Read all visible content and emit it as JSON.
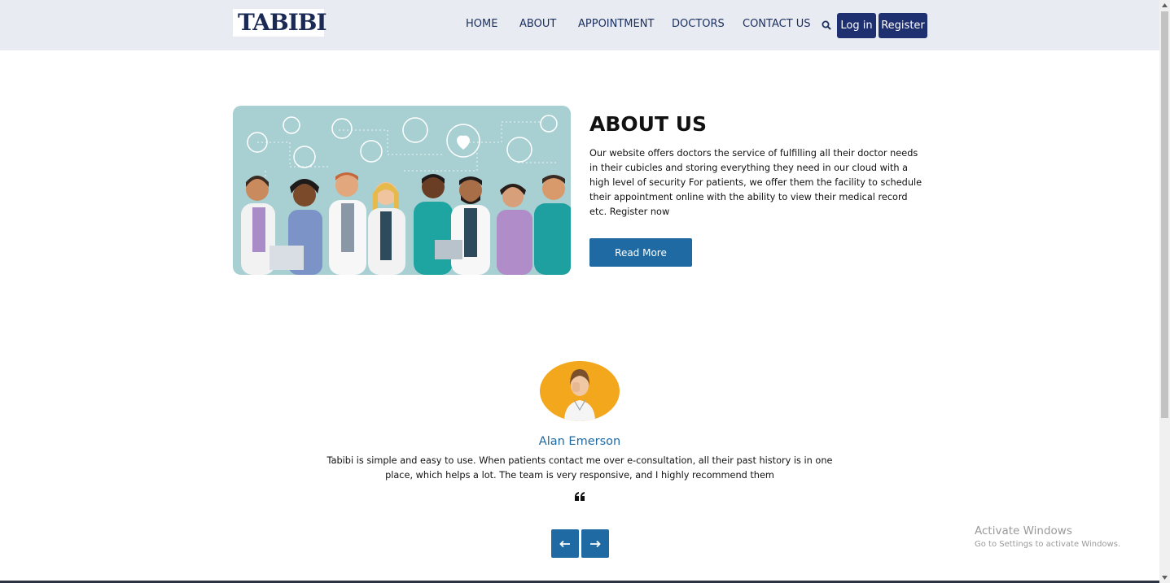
{
  "header": {
    "logo_text": "TABIBI",
    "nav": [
      "HOME",
      "ABOUT",
      "APPOINTMENT",
      "DOCTORS",
      "CONTACT US"
    ],
    "search_icon": "search-icon",
    "login_label": "Log in",
    "register_label": "Register"
  },
  "about": {
    "title": "ABOUT US",
    "text": "Our website offers doctors the service of fulfilling all their doctor needs in their cubicles and storing everything they need in our cloud with a high level of security For patients, we offer them the facility to schedule their appointment online with the ability to view their medical record etc. Register now",
    "button": "Read More"
  },
  "testimonial": {
    "name": "Alan Emerson",
    "text": "Tabibi is simple and easy to use. When patients contact me over e-consultation, all their past history is in one place, which helps a lot. The team is very responsive, and I highly recommend them",
    "quote_icon": "quote-icon",
    "prev_icon": "arrow-left-icon",
    "next_icon": "arrow-right-icon"
  },
  "windows_watermark": {
    "title": "Activate Windows",
    "subtitle": "Go to Settings to activate Windows."
  },
  "colors": {
    "topbar": "#e8ebf1",
    "navy": "#1f3070",
    "accent_blue": "#1f6aa2",
    "avatar_bg": "#f2a71d"
  }
}
